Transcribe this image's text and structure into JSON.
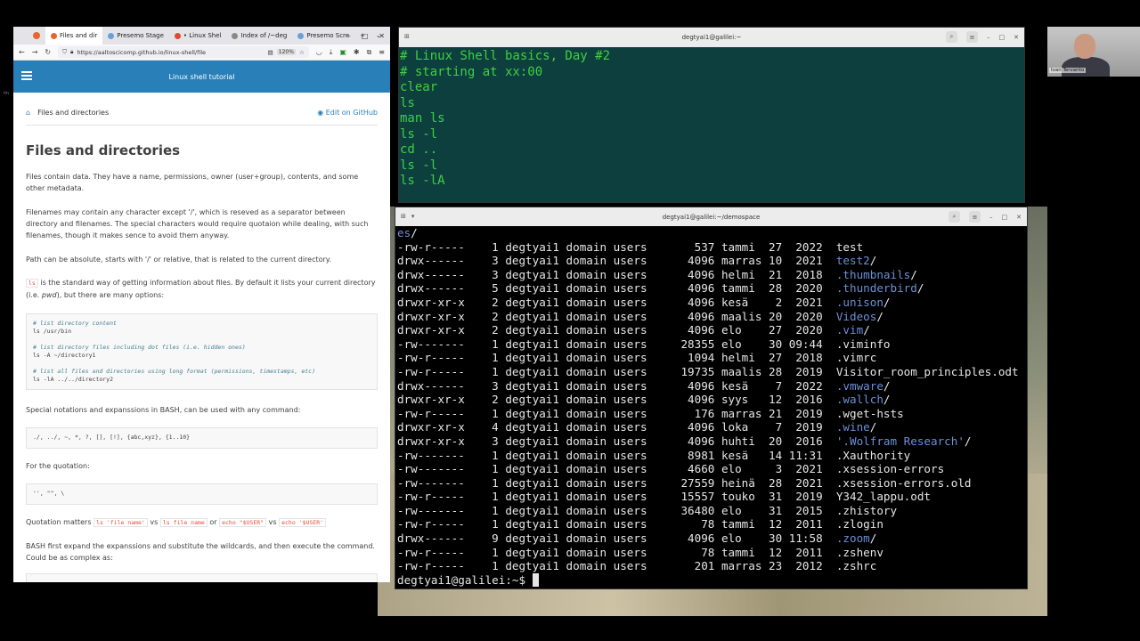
{
  "browser": {
    "tabs": [
      {
        "label": "Files and dir",
        "active": true,
        "color": "#e86530"
      },
      {
        "label": "Presemo Stage",
        "active": false,
        "color": "#6aa0d8"
      },
      {
        "label": "• Linux Shel",
        "active": false,
        "color": "#e0492c"
      },
      {
        "label": "Index of /~deg",
        "active": false,
        "color": "#888888"
      },
      {
        "label": "Presemo Scre",
        "active": false,
        "color": "#6aa0d8"
      }
    ],
    "new_tab": "+",
    "url": "https://aaltoscicomp.github.io/linux-shell/file",
    "zoom": "120%",
    "site_title": "Linux shell tutorial",
    "breadcrumb": "Files and directories",
    "edit_link": "Edit on GitHub",
    "heading": "Files and directories",
    "p1": "Files contain data. They have a name, permissions, owner (user+group), contents, and some other metadata.",
    "p2": "Filenames may contain any character except '/', which is reseved as a separator between directory and filenames. The special characters would require quotaion while dealing, with such filenames, though it makes sence to avoid them anyway.",
    "p3": "Path can be absolute, starts with '/' or relative, that is related to the current directory.",
    "p4_code": "ls",
    "p4_a": " is the standard way of getting information about files. By default it lists your current directory (i.e. ",
    "p4_em": "pwd",
    "p4_b": "), but there are many options:",
    "code1": [
      {
        "c": "# list directory content"
      },
      {
        "t": "ls /usr/bin"
      },
      {
        "t": ""
      },
      {
        "c": "# list directory files including dot files (i.e. hidden ones)"
      },
      {
        "t": "ls -A ~/directory1"
      },
      {
        "t": ""
      },
      {
        "c": "# list all files and directories using long format (permissions, timestamps, etc)"
      },
      {
        "t": "ls -lA ../../directory2"
      }
    ],
    "p5": "Special notations and expanssions in BASH, can be used with any command:",
    "code2": "./, ../, ~, *, ?, [], [!], {abc,xyz}, {1..10}",
    "p6": "For the quotation:",
    "code3": "'', \"\", \\",
    "p7_a": "Quotation matters ",
    "p7_c1": "ls 'file name'",
    "p7_vs": " vs ",
    "p7_c2": "ls file name",
    "p7_or": " or ",
    "p7_c3": "echo \"$USER\"",
    "p7_c4": "echo '$USER'",
    "p8": "BASH first expand the expanssions and substitute the wildcards, and then execute the command. Could be as complex as:"
  },
  "term1": {
    "title": "degtyai1@galilei:~",
    "lines": [
      "# Linux Shell basics, Day #2",
      "# starting at xx:00",
      "clear",
      "ls",
      "man ls",
      "ls -l",
      "cd ..",
      "ls -l",
      "ls -lA"
    ]
  },
  "term2": {
    "title": "degtyai1@galilei:~/demospace",
    "first_line": "es/",
    "rows": [
      {
        "perm": "-rw-r-----",
        "n": "1",
        "mon": "tammi",
        "day": "27",
        "yt": "2022",
        "size": "537",
        "name": "test",
        "dir": false
      },
      {
        "perm": "drwx------",
        "n": "3",
        "mon": "marras",
        "day": "10",
        "yt": "2021",
        "size": "4096",
        "name": "test2",
        "dir": true
      },
      {
        "perm": "drwx------",
        "n": "3",
        "mon": "helmi",
        "day": "21",
        "yt": "2018",
        "size": "4096",
        "name": ".thumbnails",
        "dir": true
      },
      {
        "perm": "drwx------",
        "n": "5",
        "mon": "tammi",
        "day": "28",
        "yt": "2020",
        "size": "4096",
        "name": ".thunderbird",
        "dir": true
      },
      {
        "perm": "drwxr-xr-x",
        "n": "2",
        "mon": "kesä",
        "day": "2",
        "yt": "2021",
        "size": "4096",
        "name": ".unison",
        "dir": true
      },
      {
        "perm": "drwxr-xr-x",
        "n": "2",
        "mon": "maalis",
        "day": "20",
        "yt": "2020",
        "size": "4096",
        "name": "Videos",
        "dir": true
      },
      {
        "perm": "drwxr-xr-x",
        "n": "2",
        "mon": "elo",
        "day": "27",
        "yt": "2020",
        "size": "4096",
        "name": ".vim",
        "dir": true
      },
      {
        "perm": "-rw-------",
        "n": "1",
        "mon": "elo",
        "day": "30",
        "yt": "09:44",
        "size": "28355",
        "name": ".viminfo",
        "dir": false
      },
      {
        "perm": "-rw-r-----",
        "n": "1",
        "mon": "helmi",
        "day": "27",
        "yt": "2018",
        "size": "1094",
        "name": ".vimrc",
        "dir": false
      },
      {
        "perm": "-rw-r-----",
        "n": "1",
        "mon": "maalis",
        "day": "28",
        "yt": "2019",
        "size": "19735",
        "name": "Visitor_room_principles.odt",
        "dir": false
      },
      {
        "perm": "drwx------",
        "n": "3",
        "mon": "kesä",
        "day": "7",
        "yt": "2022",
        "size": "4096",
        "name": ".vmware",
        "dir": true
      },
      {
        "perm": "drwxr-xr-x",
        "n": "2",
        "mon": "syys",
        "day": "12",
        "yt": "2016",
        "size": "4096",
        "name": ".wallch",
        "dir": true
      },
      {
        "perm": "-rw-r-----",
        "n": "1",
        "mon": "marras",
        "day": "21",
        "yt": "2019",
        "size": "176",
        "name": ".wget-hsts",
        "dir": false
      },
      {
        "perm": "drwxr-xr-x",
        "n": "4",
        "mon": "loka",
        "day": "7",
        "yt": "2019",
        "size": "4096",
        "name": ".wine",
        "dir": true
      },
      {
        "perm": "drwxr-xr-x",
        "n": "3",
        "mon": "huhti",
        "day": "20",
        "yt": "2016",
        "size": "4096",
        "name": "'.Wolfram Research'",
        "dir": true
      },
      {
        "perm": "-rw-------",
        "n": "1",
        "mon": "kesä",
        "day": "14",
        "yt": "11:31",
        "size": "8981",
        "name": ".Xauthority",
        "dir": false
      },
      {
        "perm": "-rw-------",
        "n": "1",
        "mon": "elo",
        "day": "3",
        "yt": "2021",
        "size": "4660",
        "name": ".xsession-errors",
        "dir": false
      },
      {
        "perm": "-rw-------",
        "n": "1",
        "mon": "heinä",
        "day": "28",
        "yt": "2021",
        "size": "27559",
        "name": ".xsession-errors.old",
        "dir": false
      },
      {
        "perm": "-rw-r-----",
        "n": "1",
        "mon": "touko",
        "day": "31",
        "yt": "2019",
        "size": "15557",
        "name": "Y342_lappu.odt",
        "dir": false
      },
      {
        "perm": "-rw-------",
        "n": "1",
        "mon": "elo",
        "day": "31",
        "yt": "2015",
        "size": "36480",
        "name": ".zhistory",
        "dir": false
      },
      {
        "perm": "-rw-r-----",
        "n": "1",
        "mon": "tammi",
        "day": "12",
        "yt": "2011",
        "size": "78",
        "name": ".zlogin",
        "dir": false
      },
      {
        "perm": "drwx------",
        "n": "9",
        "mon": "elo",
        "day": "30",
        "yt": "11:58",
        "size": "4096",
        "name": ".zoom",
        "dir": true
      },
      {
        "perm": "-rw-r-----",
        "n": "1",
        "mon": "tammi",
        "day": "12",
        "yt": "2011",
        "size": "78",
        "name": ".zshenv",
        "dir": false
      },
      {
        "perm": "-rw-r-----",
        "n": "1",
        "mon": "marras",
        "day": "23",
        "yt": "2012",
        "size": "201",
        "name": ".zshrc",
        "dir": false
      }
    ],
    "owner": "degtyai1 domain users",
    "prompt": "degtyai1@galilei:~$"
  },
  "webcam": {
    "name": "Ivan Tervanto"
  },
  "side_note": "lin"
}
